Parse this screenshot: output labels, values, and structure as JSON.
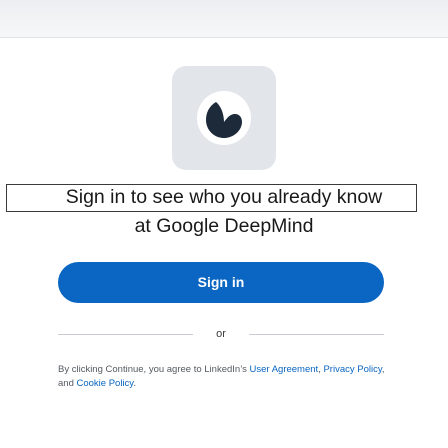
{
  "heading": {
    "line1": "Sign in to see who you already know",
    "line2": "at Google DeepMind"
  },
  "logo": {
    "icon": "google-deepmind-logo-icon",
    "background": "#e2e5ea"
  },
  "signin": {
    "label": "Sign in",
    "color": "#0a66c2"
  },
  "divider": {
    "label": "or"
  },
  "legal": {
    "prefix": "By clicking Continue, you agree to LinkedIn’s ",
    "user_agreement": "User Agreement",
    "sep1": ", ",
    "privacy_policy": "Privacy Policy",
    "sep2": ", and ",
    "cookie_policy": "Cookie Policy",
    "suffix": "."
  }
}
